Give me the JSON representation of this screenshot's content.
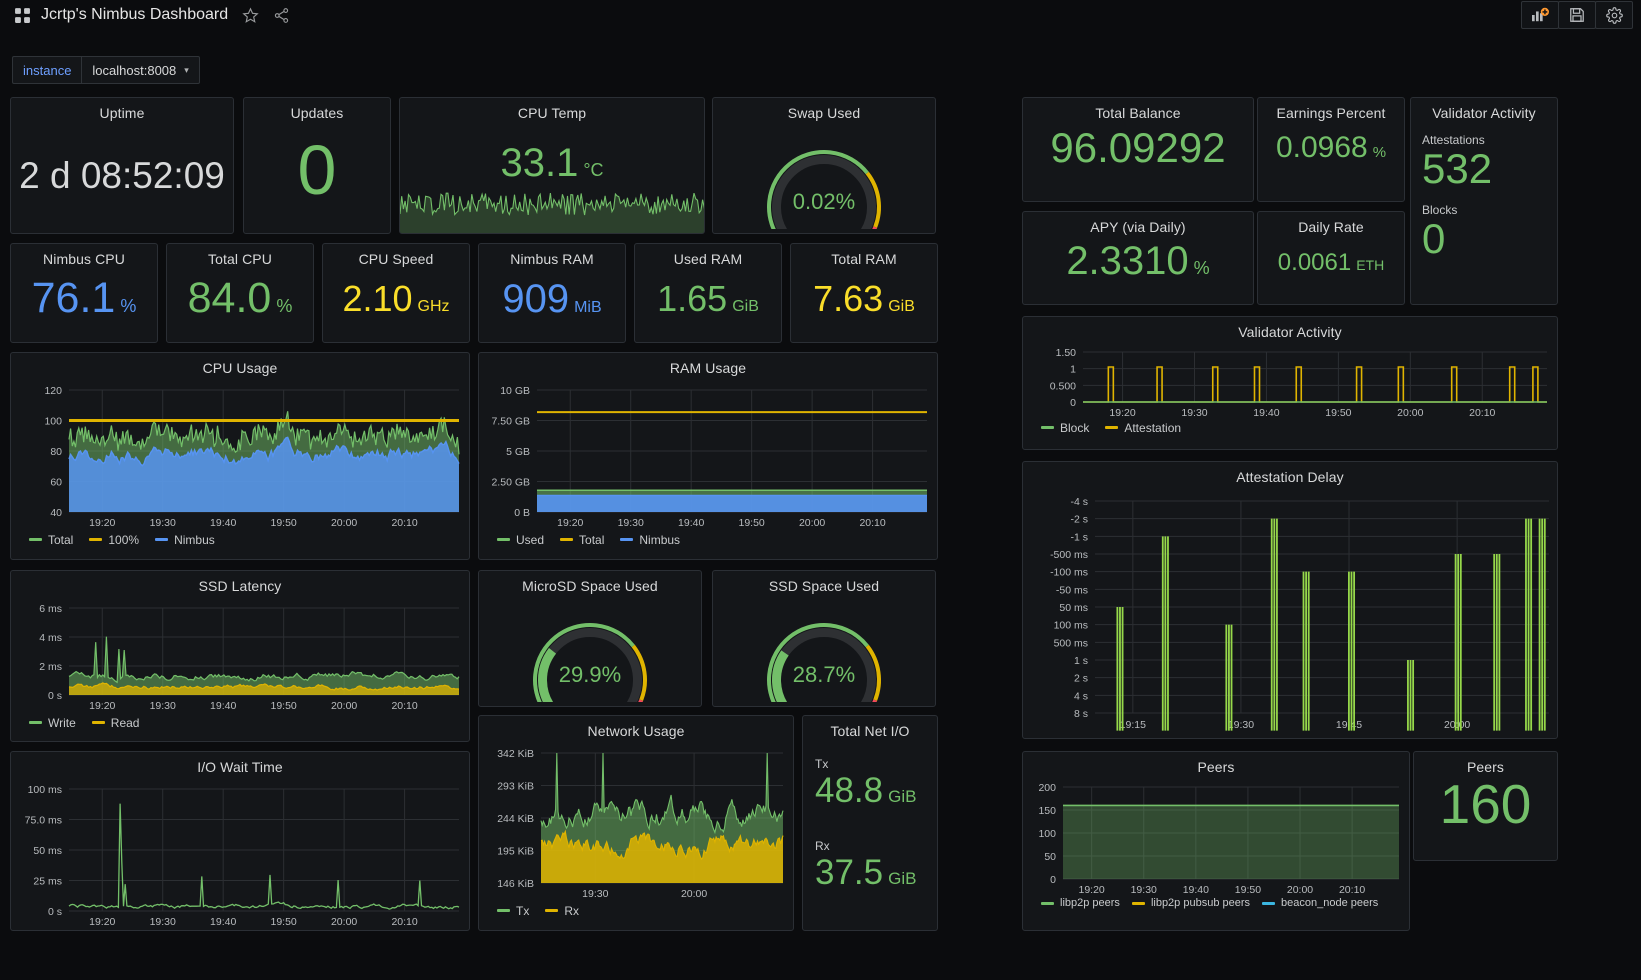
{
  "header": {
    "title": "Jcrtp's Nimbus Dashboard",
    "grid_icon": "dashboard-grid-icon",
    "star_icon": "star-icon",
    "share_icon": "share-icon",
    "buttons": [
      {
        "name": "add-panel-button",
        "icon": "add-panel-icon"
      },
      {
        "name": "save-dashboard-button",
        "icon": "save-icon"
      },
      {
        "name": "dashboard-settings-button",
        "icon": "gear-icon"
      }
    ]
  },
  "variables": {
    "instance": {
      "label": "instance",
      "value": "localhost:8008"
    }
  },
  "colors": {
    "green": "#73bf69",
    "blue": "#5794f2",
    "yellow": "#fade2a",
    "orange": "#ff9830",
    "dark_yellow": "#e0b400",
    "red": "#f2495c",
    "text": "#d8d9da"
  },
  "stats": {
    "uptime": {
      "title": "Uptime",
      "value": "2 d 08:52:09",
      "unit": "",
      "color": "#d8d9da"
    },
    "updates": {
      "title": "Updates",
      "value": "0",
      "unit": "",
      "color": "#73bf69"
    },
    "cpu_temp": {
      "title": "CPU Temp",
      "value": "33.1",
      "unit": "°C",
      "color": "#73bf69"
    },
    "swap_used": {
      "title": "Swap Used",
      "value": "0.02%",
      "unit": "",
      "color": "#73bf69",
      "percent": 0.02
    },
    "nimbus_cpu": {
      "title": "Nimbus CPU",
      "value": "76.1",
      "unit": "%",
      "color": "#5794f2"
    },
    "total_cpu": {
      "title": "Total CPU",
      "value": "84.0",
      "unit": "%",
      "color": "#73bf69"
    },
    "cpu_speed": {
      "title": "CPU Speed",
      "value": "2.10",
      "unit": "GHz",
      "color": "#fade2a"
    },
    "nimbus_ram": {
      "title": "Nimbus RAM",
      "value": "909",
      "unit": "MiB",
      "color": "#5794f2"
    },
    "used_ram": {
      "title": "Used RAM",
      "value": "1.65",
      "unit": "GiB",
      "color": "#73bf69"
    },
    "total_ram": {
      "title": "Total RAM",
      "value": "7.63",
      "unit": "GiB",
      "color": "#fade2a"
    },
    "microsd": {
      "title": "MicroSD Space Used",
      "value": "29.9%",
      "percent": 29.9,
      "color": "#73bf69"
    },
    "ssd": {
      "title": "SSD Space Used",
      "value": "28.7%",
      "percent": 28.7,
      "color": "#73bf69"
    },
    "total_net_io": {
      "title": "Total Net I/O",
      "tx_label": "Tx",
      "tx_value": "48.8",
      "tx_unit": "GiB",
      "rx_label": "Rx",
      "rx_value": "37.5",
      "rx_unit": "GiB",
      "color": "#73bf69"
    },
    "total_balance": {
      "title": "Total Balance",
      "value": "96.09292",
      "unit": "",
      "color": "#73bf69"
    },
    "earnings_pct": {
      "title": "Earnings Percent",
      "value": "0.0968",
      "unit": "%",
      "color": "#73bf69"
    },
    "apy": {
      "title": "APY (via Daily)",
      "value": "2.3310",
      "unit": "%",
      "color": "#73bf69"
    },
    "daily_rate": {
      "title": "Daily Rate",
      "value": "0.0061",
      "unit": "ETH",
      "color": "#73bf69"
    },
    "validator_activity_stat": {
      "title": "Validator Activity",
      "rows": [
        {
          "label": "Attestations",
          "value": "532"
        },
        {
          "label": "Blocks",
          "value": "0"
        }
      ],
      "color": "#73bf69"
    },
    "peers_stat": {
      "title": "Peers",
      "value": "160",
      "unit": "",
      "color": "#73bf69"
    }
  },
  "chart_data": [
    {
      "id": "cpu_usage",
      "type": "area",
      "title": "CPU Usage",
      "xlabel": "",
      "ylabel": "",
      "ylim": [
        40,
        120
      ],
      "yticks": [
        "40",
        "60",
        "80",
        "100",
        "120"
      ],
      "xticks": [
        "19:20",
        "19:30",
        "19:40",
        "19:50",
        "20:00",
        "20:10"
      ],
      "grid": true,
      "legend_position": "bottom",
      "series": [
        {
          "name": "Total",
          "color": "#73bf69",
          "mean": 88,
          "amp": 11
        },
        {
          "name": "100%",
          "color": "#e0b400",
          "constant": 100
        },
        {
          "name": "Nimbus",
          "color": "#5794f2",
          "mean": 78,
          "amp": 9
        }
      ]
    },
    {
      "id": "ram_usage",
      "type": "area",
      "title": "RAM Usage",
      "ylim": [
        0,
        10
      ],
      "yticks": [
        "0 B",
        "2.50 GB",
        "5 GB",
        "7.50 GB",
        "10 GB"
      ],
      "xticks": [
        "19:20",
        "19:30",
        "19:40",
        "19:50",
        "20:00",
        "20:10"
      ],
      "grid": true,
      "legend_position": "bottom",
      "series": [
        {
          "name": "Used",
          "color": "#73bf69",
          "constant": 1.78
        },
        {
          "name": "Total",
          "color": "#e0b400",
          "constant": 8.19
        },
        {
          "name": "Nimbus",
          "color": "#5794f2",
          "constant": 1.35
        }
      ]
    },
    {
      "id": "ssd_latency",
      "type": "area",
      "title": "SSD Latency",
      "ylim": [
        0,
        6
      ],
      "yticks": [
        "0 s",
        "2 ms",
        "4 ms",
        "6 ms"
      ],
      "xticks": [
        "19:20",
        "19:30",
        "19:40",
        "19:50",
        "20:00",
        "20:10"
      ],
      "grid": true,
      "legend_position": "bottom",
      "series": [
        {
          "name": "Write",
          "color": "#73bf69",
          "mean": 1.4,
          "amp": 0.5,
          "spikes": true
        },
        {
          "name": "Read",
          "color": "#e0b400",
          "mean": 0.6,
          "amp": 0.3
        }
      ]
    },
    {
      "id": "io_wait",
      "type": "line",
      "title": "I/O Wait Time",
      "ylim": [
        0,
        100
      ],
      "yticks": [
        "0 s",
        "25 ms",
        "50 ms",
        "75.0 ms",
        "100 ms"
      ],
      "xticks": [
        "19:20",
        "19:30",
        "19:40",
        "19:50",
        "20:00",
        "20:10"
      ],
      "grid": true,
      "legend_position": "none",
      "series": [
        {
          "name": "I/O Wait",
          "color": "#73bf69",
          "mean": 5,
          "amp": 4,
          "spikes": true
        }
      ]
    },
    {
      "id": "network_usage",
      "type": "area",
      "title": "Network Usage",
      "ylim": [
        146,
        342
      ],
      "yticks": [
        "146 KiB",
        "195 KiB",
        "244 KiB",
        "293 KiB",
        "342 KiB"
      ],
      "xticks": [
        "19:30",
        "20:00"
      ],
      "grid": true,
      "legend_position": "bottom",
      "series": [
        {
          "name": "Tx",
          "color": "#73bf69",
          "mean": 250,
          "amp": 30
        },
        {
          "name": "Rx",
          "color": "#e0b400",
          "mean": 205,
          "amp": 22
        }
      ]
    },
    {
      "id": "validator_activity",
      "type": "line",
      "title": "Validator Activity",
      "ylim": [
        0,
        1.5
      ],
      "yticks": [
        "0",
        "0.500",
        "1",
        "1.50"
      ],
      "xticks": [
        "19:20",
        "19:30",
        "19:40",
        "19:50",
        "20:00",
        "20:10"
      ],
      "grid": true,
      "legend_position": "bottom",
      "series": [
        {
          "name": "Block",
          "color": "#73bf69",
          "pulses": []
        },
        {
          "name": "Attestation",
          "color": "#e0b400",
          "pulses": [
            0.06,
            0.165,
            0.285,
            0.375,
            0.465,
            0.595,
            0.685,
            0.8,
            0.925,
            0.975
          ]
        }
      ]
    },
    {
      "id": "attestation_delay",
      "type": "scatter",
      "title": "Attestation Delay",
      "yticks": [
        "-4 s",
        "-2 s",
        "-1 s",
        "-500 ms",
        "-100 ms",
        "-50 ms",
        "50 ms",
        "100 ms",
        "500 ms",
        "1 s",
        "2 s",
        "4 s",
        "8 s"
      ],
      "xticks": [
        "19:15",
        "19:30",
        "19:45",
        "20:00"
      ],
      "grid": true,
      "legend_position": "none",
      "series": [
        {
          "name": "Delay",
          "color": "#96d84a",
          "bars": [
            {
              "x": 0.055,
              "top": 6,
              "bottom": 13
            },
            {
              "x": 0.155,
              "top": 2,
              "bottom": 13
            },
            {
              "x": 0.295,
              "top": 7,
              "bottom": 13
            },
            {
              "x": 0.395,
              "top": 1,
              "bottom": 13
            },
            {
              "x": 0.465,
              "top": 4,
              "bottom": 13
            },
            {
              "x": 0.565,
              "top": 4,
              "bottom": 13
            },
            {
              "x": 0.695,
              "top": 9,
              "bottom": 13
            },
            {
              "x": 0.8,
              "top": 3,
              "bottom": 13
            },
            {
              "x": 0.885,
              "top": 3,
              "bottom": 13
            },
            {
              "x": 0.955,
              "top": 1,
              "bottom": 13
            },
            {
              "x": 0.985,
              "top": 1,
              "bottom": 13
            }
          ]
        }
      ]
    },
    {
      "id": "peers_chart",
      "type": "area",
      "title": "Peers",
      "ylim": [
        0,
        200
      ],
      "yticks": [
        "0",
        "50",
        "100",
        "150",
        "200"
      ],
      "xticks": [
        "19:20",
        "19:30",
        "19:40",
        "19:50",
        "20:00",
        "20:10"
      ],
      "grid": true,
      "legend_position": "bottom",
      "series": [
        {
          "name": "libp2p peers",
          "color": "#73bf69",
          "constant": 160
        },
        {
          "name": "libp2p pubsub peers",
          "color": "#e0b400",
          "constant": 0
        },
        {
          "name": "beacon_node peers",
          "color": "#3bb6e0",
          "constant": 0
        }
      ]
    }
  ]
}
